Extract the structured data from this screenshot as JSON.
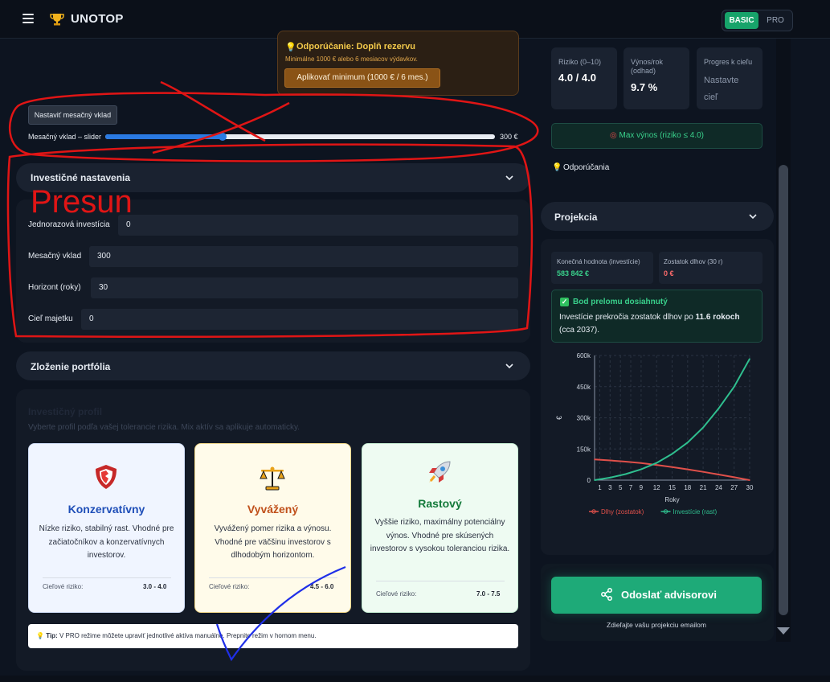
{
  "header": {
    "app_name": "UNOTOP",
    "mode_basic": "BASIC",
    "mode_pro": "PRO",
    "icons": {
      "menu": "hamburger-icon",
      "logo": "trophy-icon"
    }
  },
  "reserve_recommendation": {
    "title": "Odporúčanie: Doplň rezervu",
    "subtitle": "Minimálne 1000 € alebo 6 mesiacov výdavkov.",
    "button": "Aplikovať minimum (1000 € / 6 mes.)"
  },
  "monthly_slider": {
    "set_button": "Nastaviť mesačný vklad",
    "label": "Mesačný vklad – slider",
    "value_text": "300 €",
    "fill_fraction": 0.3
  },
  "investment_settings": {
    "title": "Investičné nastavenia",
    "fields": [
      {
        "label": "Jednorazová investícia",
        "value": "0"
      },
      {
        "label": "Mesačný vklad",
        "value": "300"
      },
      {
        "label": "Horizont (roky)",
        "value": "30"
      },
      {
        "label": "Cieľ majetku",
        "value": "0"
      }
    ]
  },
  "portfolio": {
    "title": "Zloženie portfólia",
    "profile_title": "Investičný profil",
    "profile_subtitle": "Vyberte profil podľa vašej tolerancie rizika. Mix aktív sa aplikuje automaticky.",
    "cards": [
      {
        "name": "Konzervatívny",
        "description": "Nízke riziko, stabilný rast. Vhodné pre začiatočníkov a konzervatívnych investorov.",
        "risk_label": "Cieľové riziko:",
        "risk_value": "3.0 - 4.0",
        "icon": "shield-icon",
        "bg": "#f0f5ff",
        "name_color": "#1f4fb8"
      },
      {
        "name": "Vyvážený",
        "description": "Vyvážený pomer rizika a výnosu. Vhodné pre väčšinu investorov s dlhodobým horizontom.",
        "risk_label": "Cieľové riziko:",
        "risk_value": "4.5 - 6.0",
        "icon": "scales-icon",
        "bg": "#fffbea",
        "name_color": "#c0501a"
      },
      {
        "name": "Rastový",
        "description": "Vyššie riziko, maximálny potenciálny výnos. Vhodné pre skúsených investorov s vysokou toleranciou rizika.",
        "risk_label": "Cieľové riziko:",
        "risk_value": "7.0 - 7.5",
        "icon": "rocket-icon",
        "bg": "#eefbf2",
        "name_color": "#137a3a"
      }
    ],
    "tip_label": "Tip:",
    "tip_text": "V PRO režime môžete upraviť jednotlivé aktíva manuálne. Prepnite režim v hornom menu."
  },
  "stats": [
    {
      "label": "Riziko (0–10)",
      "value": "4.0 / 4.0"
    },
    {
      "label": "Výnos/rok (odhad)",
      "value": "9.7 %"
    },
    {
      "label": "Progres k cieľu",
      "value": "Nastavte cieľ"
    }
  ],
  "max_return_button": "Max výnos (riziko ≤ 4.0)",
  "recommendations_label": "Odporúčania",
  "projection": {
    "title": "Projekcia",
    "final_value_label": "Konečná hodnota (investície)",
    "final_value": "583 842 €",
    "debt_label": "Zostatok dlhov (30 r)",
    "debt_value": "0 €",
    "breakeven_title": "Bod prelomu dosiahnutý",
    "breakeven_text_prefix": "Investície prekročia zostatok dlhov po ",
    "breakeven_years": "11.6 rokoch",
    "breakeven_text_suffix": " (cca 2037)."
  },
  "chart_data": {
    "type": "line",
    "xlabel": "Roky",
    "ylabel": "€",
    "x_ticks": [
      "1",
      "3",
      "5",
      "7",
      "9",
      "12",
      "15",
      "18",
      "21",
      "24",
      "27",
      "30"
    ],
    "y_ticks": [
      "0",
      "150k",
      "300k",
      "450k",
      "600k"
    ],
    "ylim": [
      0,
      600000
    ],
    "xlim": [
      0,
      30
    ],
    "grid": true,
    "legend_position": "bottom",
    "series": [
      {
        "name": "Dlhy (zostatok)",
        "color": "#e0504a",
        "x": [
          0,
          3,
          6,
          9,
          12,
          15,
          18,
          21,
          24,
          27,
          30
        ],
        "y": [
          100000,
          95000,
          89000,
          82000,
          73000,
          63000,
          52000,
          40000,
          27000,
          14000,
          0
        ]
      },
      {
        "name": "Investície (rast)",
        "color": "#2fbf8f",
        "x": [
          0,
          3,
          6,
          9,
          12,
          15,
          18,
          21,
          24,
          27,
          30
        ],
        "y": [
          0,
          12000,
          29000,
          52000,
          83000,
          126000,
          181000,
          253000,
          345000,
          450000,
          583842
        ]
      }
    ]
  },
  "send": {
    "button": "Odoslať advisorovi",
    "subtitle": "Zdieľajte vašu projekciu emailom"
  },
  "annotations": {
    "handwritten_text": "Presun"
  }
}
